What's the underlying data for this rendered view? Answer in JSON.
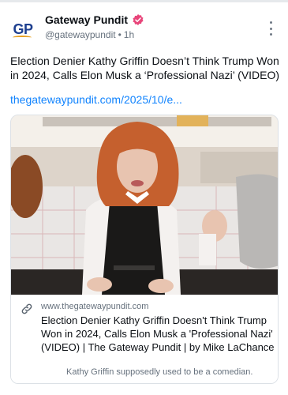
{
  "post": {
    "avatar_text": "GP",
    "display_name": "Gateway Pundit",
    "handle": "@gatewaypundit",
    "separator": "•",
    "timestamp": "1h",
    "text": "Election Denier Kathy Griffin Doesn’t Think Trump Won in 2024, Calls Elon Musk a ‘Professional Nazi’ (VIDEO)",
    "link_text": "thegatewaypundit.com/2025/10/e..."
  },
  "card": {
    "domain": "www.thegatewaypundit.com",
    "title": "Election Denier Kathy Griffin Doesn't Think Trump Won in 2024, Calls Elon Musk a 'Professional Nazi' (VIDEO) | The Gateway Pundit | by Mike LaChance",
    "description": "Kathy Griffin supposedly used to be a comedian."
  },
  "colors": {
    "accent": "#1083fe",
    "verified": "#e8457a",
    "muted": "#66717d",
    "avatar_blue": "#1d3f8f",
    "avatar_orange": "#e7a020"
  },
  "icons": {
    "verified": "verified-badge-icon",
    "more": "more-vertical-icon",
    "link": "link-icon"
  }
}
